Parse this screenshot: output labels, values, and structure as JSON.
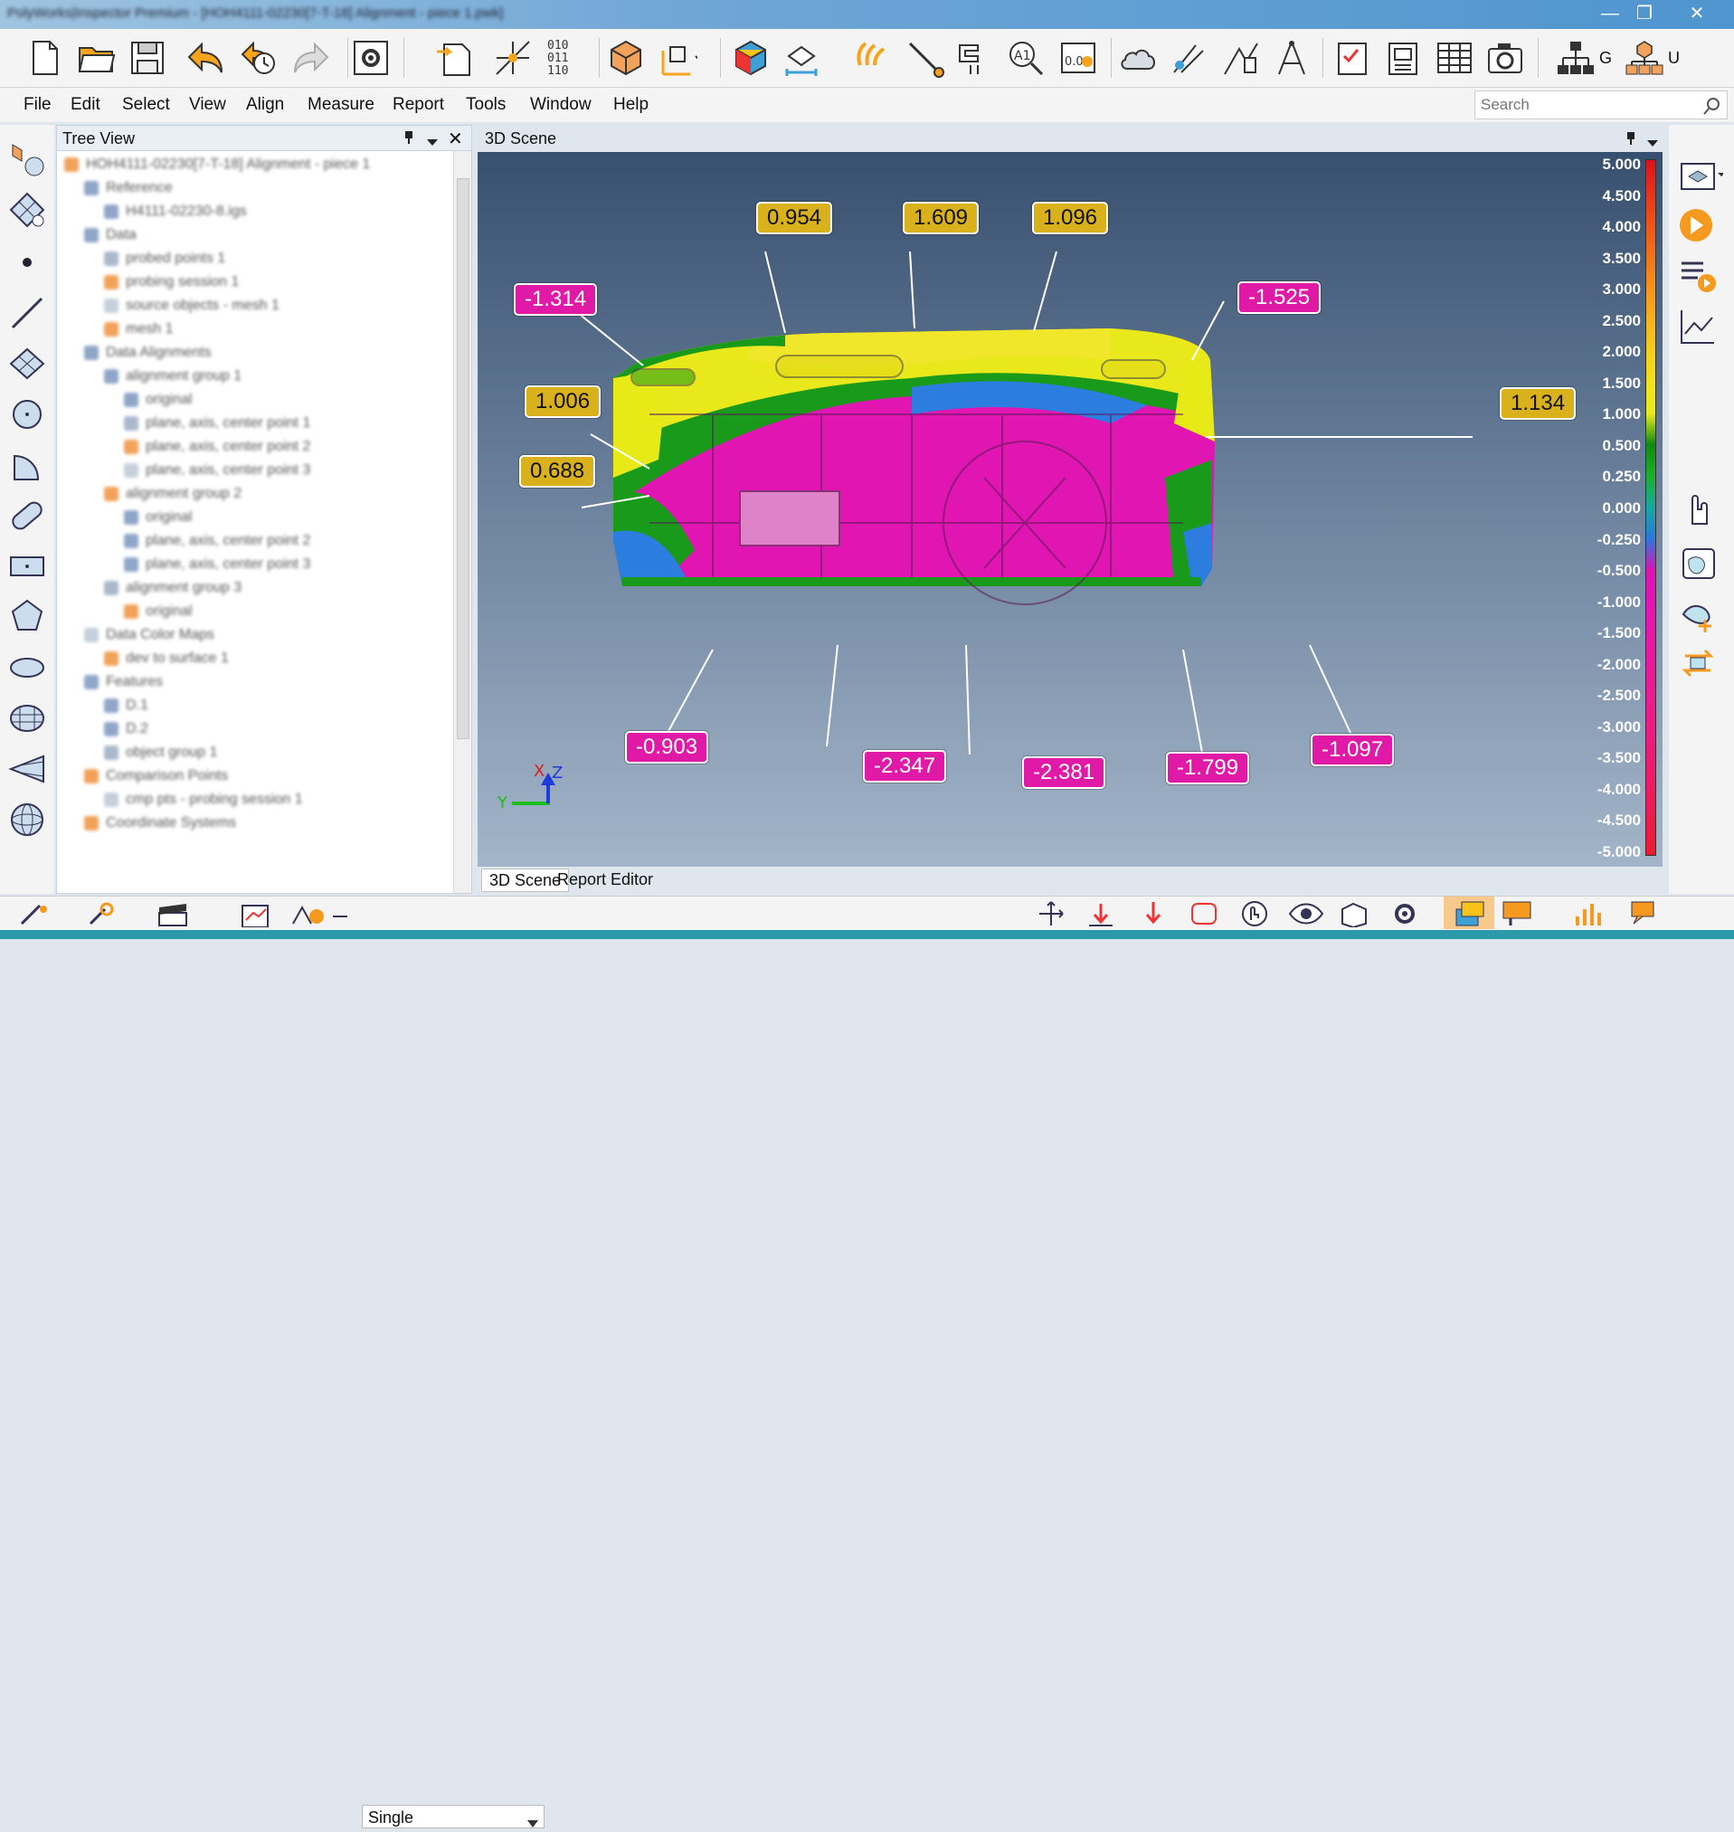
{
  "window": {
    "title": "PolyWorks|Inspector Premium - [HOH4111-02230[7-T-18] Alignment - piece 1.pwk]",
    "minimize": "—",
    "maximize": "❐",
    "close": "✕"
  },
  "toolbar": {
    "icons": [
      "new-file-icon",
      "open-folder-icon",
      "save-icon",
      "undo-icon",
      "undo-history-icon",
      "redo-icon",
      "settings-icon",
      "import-icon",
      "align-icon",
      "binary-data-icon",
      "cube-icon",
      "measure-icon",
      "color-map-icon",
      "feature-icon",
      "probe-icon",
      "gauge-icon",
      "caliper-icon",
      "text-annotation-icon",
      "table-icon",
      "cloud-icon",
      "section-icon",
      "chart-icon",
      "compass-icon",
      "report-check-icon",
      "snapshot-report-icon",
      "spreadsheet-icon",
      "camera-icon",
      "tree-icon",
      "network-icon"
    ],
    "g_label": "G",
    "u_label": "U"
  },
  "menu": [
    "File",
    "Edit",
    "Select",
    "View",
    "Align",
    "Measure",
    "Report",
    "Tools",
    "Window",
    "Help"
  ],
  "search": {
    "placeholder": "Search"
  },
  "tree": {
    "title": "Tree View",
    "rows": [
      {
        "text": "HOH4111-02230[7-T-18] Alignment - piece 1",
        "indent": 0
      },
      {
        "text": "Reference",
        "indent": 1
      },
      {
        "text": "H4111-02230-8.igs",
        "indent": 2
      },
      {
        "text": "Data",
        "indent": 1
      },
      {
        "text": "probed points 1",
        "indent": 2
      },
      {
        "text": "probing session 1",
        "indent": 2
      },
      {
        "text": "source objects - mesh 1",
        "indent": 2
      },
      {
        "text": "mesh 1",
        "indent": 2
      },
      {
        "text": "Data Alignments",
        "indent": 1
      },
      {
        "text": "alignment group 1",
        "indent": 2
      },
      {
        "text": "original",
        "indent": 3
      },
      {
        "text": "plane, axis, center point 1",
        "indent": 3
      },
      {
        "text": "plane, axis, center point 2",
        "indent": 3
      },
      {
        "text": "plane, axis, center point 3",
        "indent": 3
      },
      {
        "text": "alignment group 2",
        "indent": 2
      },
      {
        "text": "original",
        "indent": 3
      },
      {
        "text": "plane, axis, center point 2",
        "indent": 3
      },
      {
        "text": "plane, axis, center point 3",
        "indent": 3
      },
      {
        "text": "alignment group 3",
        "indent": 2
      },
      {
        "text": "original",
        "indent": 3
      },
      {
        "text": "Data Color Maps",
        "indent": 1
      },
      {
        "text": "dev to surface 1",
        "indent": 2
      },
      {
        "text": "Features",
        "indent": 1
      },
      {
        "text": "D.1",
        "indent": 2
      },
      {
        "text": "D.2",
        "indent": 2
      },
      {
        "text": "object group 1",
        "indent": 2
      },
      {
        "text": "Comparison Points",
        "indent": 1
      },
      {
        "text": "cmp pts - probing session 1",
        "indent": 2
      },
      {
        "text": "Coordinate Systems",
        "indent": 1
      }
    ]
  },
  "scene": {
    "title": "3D Scene",
    "labels": [
      {
        "text": "0.954",
        "kind": "pos"
      },
      {
        "text": "1.609",
        "kind": "pos"
      },
      {
        "text": "1.096",
        "kind": "pos"
      },
      {
        "text": "-1.314",
        "kind": "neg"
      },
      {
        "text": "-1.525",
        "kind": "neg"
      },
      {
        "text": "1.006",
        "kind": "pos"
      },
      {
        "text": "1.134",
        "kind": "pos"
      },
      {
        "text": "0.688",
        "kind": "pos"
      },
      {
        "text": "-0.903",
        "kind": "neg"
      },
      {
        "text": "-2.347",
        "kind": "neg"
      },
      {
        "text": "-2.381",
        "kind": "neg"
      },
      {
        "text": "-1.799",
        "kind": "neg"
      },
      {
        "text": "-1.097",
        "kind": "neg"
      }
    ],
    "axes": {
      "x": "X",
      "y": "Y",
      "z": "Z"
    },
    "legend": [
      "5.000",
      "4.500",
      "4.000",
      "3.500",
      "3.000",
      "2.500",
      "2.000",
      "1.500",
      "1.000",
      "0.500",
      "0.250",
      "0.000",
      "-0.250",
      "-0.500",
      "-1.000",
      "-1.500",
      "-2.000",
      "-2.500",
      "-3.000",
      "-3.500",
      "-4.000",
      "-4.500",
      "-5.000"
    ],
    "legend_colors": [
      "#e0101a",
      "#e8321a",
      "#ee5218",
      "#f0721a",
      "#f4921c",
      "#f7b01c",
      "#f7cc1c",
      "#f4e01c",
      "#e8ee1a",
      "#108a10",
      "#1ab02a",
      "#18a8a0",
      "#2878e0",
      "#e012b0",
      "#e414b4",
      "#e816a8",
      "#ea189c",
      "#ec1a90",
      "#ee1a82",
      "#ef1a72",
      "#ef1a60",
      "#ef1a48",
      "#ef1a30"
    ]
  },
  "scene_tabs": [
    "3D Scene",
    "Report Editor"
  ],
  "bottom": {
    "mode_select": "Single"
  }
}
